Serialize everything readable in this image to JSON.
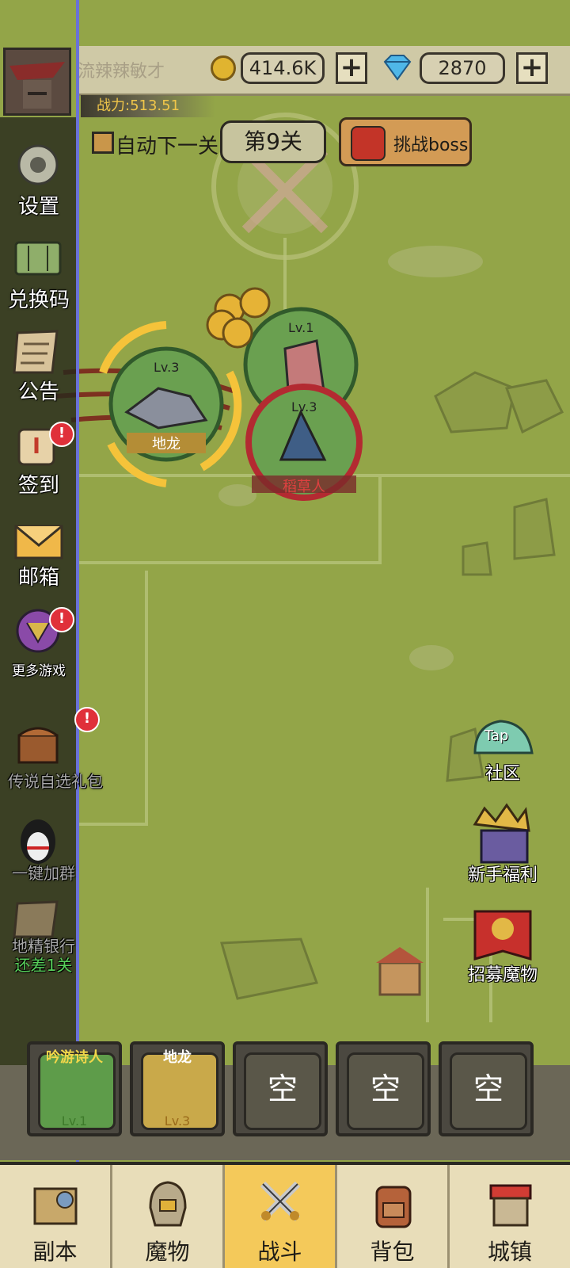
{
  "player": {
    "name": "流辣辣敏才",
    "power": "战力:513.51"
  },
  "currency": {
    "gold": "414.6K",
    "gems": "2870",
    "plus": "+"
  },
  "stage": {
    "auto_next_label": "自动下一关",
    "level_label": "第9关",
    "boss_label": "挑战boss"
  },
  "sidebar": {
    "items": [
      {
        "label": "设置",
        "icon": "gear-icon"
      },
      {
        "label": "兑换码",
        "icon": "ticket-icon"
      },
      {
        "label": "公告",
        "icon": "notice-icon"
      },
      {
        "label": "签到",
        "icon": "scroll-icon",
        "badge": "!"
      },
      {
        "label": "邮箱",
        "icon": "mail-icon"
      },
      {
        "label": "更多游戏",
        "icon": "more-games-icon",
        "badge": "!"
      },
      {
        "label": "传说自选礼包",
        "icon": "treasure-chest-icon",
        "badge": "!"
      },
      {
        "label": "一键加群",
        "icon": "penguin-icon"
      },
      {
        "label": "地精银行",
        "icon": "bank-icon",
        "sub": "还差1关"
      }
    ]
  },
  "right_features": [
    {
      "label": "社区",
      "icon": "community-icon",
      "icon_text": "Tap"
    },
    {
      "label": "新手福利",
      "icon": "king-icon"
    },
    {
      "label": "招募魔物",
      "icon": "recruit-banner-icon"
    }
  ],
  "battle": {
    "units": [
      {
        "name": "地龙",
        "level": "Lv.3",
        "side": "ally"
      },
      {
        "name": "",
        "level": "Lv.1",
        "side": "ally"
      },
      {
        "name": "稻草人",
        "level": "Lv.3",
        "side": "enemy"
      }
    ]
  },
  "team_slots": [
    {
      "name": "吟游诗人",
      "level": "Lv.1",
      "filled": true,
      "color": "#5e9c4a"
    },
    {
      "name": "地龙",
      "level": "Lv.3",
      "filled": true,
      "color": "#c9a94a"
    },
    {
      "label": "空",
      "filled": false
    },
    {
      "label": "空",
      "filled": false
    },
    {
      "label": "空",
      "filled": false
    }
  ],
  "bottom_nav": {
    "tabs": [
      {
        "label": "副本",
        "icon": "map-icon",
        "active": false
      },
      {
        "label": "魔物",
        "icon": "helmet-icon",
        "active": false
      },
      {
        "label": "战斗",
        "icon": "crossed-swords-icon",
        "active": true
      },
      {
        "label": "背包",
        "icon": "backpack-icon",
        "active": false
      },
      {
        "label": "城镇",
        "icon": "shop-icon",
        "active": false
      }
    ]
  },
  "colors": {
    "map_bg": "#93a548",
    "ally_ring": "#7cc45a",
    "enemy_ring": "#c8363c",
    "active_tab": "#f4c95a"
  }
}
